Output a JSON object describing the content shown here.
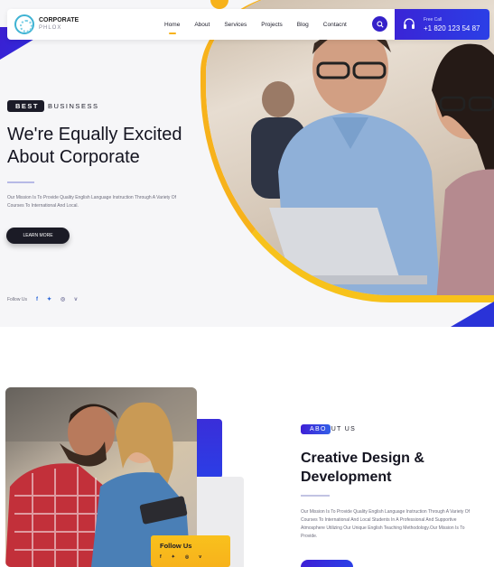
{
  "nav": {
    "logo_title": "CORPORATE",
    "logo_sub": "PHLOX",
    "menu": [
      "Home",
      "About",
      "Services",
      "Projects",
      "Blog",
      "Contacnt"
    ],
    "active_item": "Home",
    "call_label": "Free Call",
    "call_number": "+1 820 123 54 87"
  },
  "hero": {
    "tag_pill": "BEST",
    "tag_rest": "BUSINSESS",
    "title_line1": "We're Equally Excited",
    "title_line2": "About Corporate",
    "description": "Our Mission Is To Provide Quality English Language Instruction Through A Variety Of Courses To International And Local.",
    "button_label": "LEARN MORE",
    "follow_label": "Follow Us",
    "social_icons": [
      "f",
      "✉",
      "◎",
      "v"
    ]
  },
  "about": {
    "tag_pill": "ABO",
    "tag_rest": "UT US",
    "title_line1": "Creative Design &",
    "title_line2": "Development",
    "description": "Our Mission Is To Provide Quality English Language Instruction Through A Variety Of Courses To International And Local Students In A Professional And Supportive Atmosphere Utilizing Our Unique English Teaching Methodology.Our Mission Is To Provide.",
    "follow_card_title": "Follow Us",
    "follow_card_icons": [
      "f",
      "✉",
      "◎",
      "v"
    ]
  },
  "colors": {
    "brand_blue": "#3421c9",
    "accent_yellow": "#f7b21b",
    "dark": "#1b1b28"
  }
}
